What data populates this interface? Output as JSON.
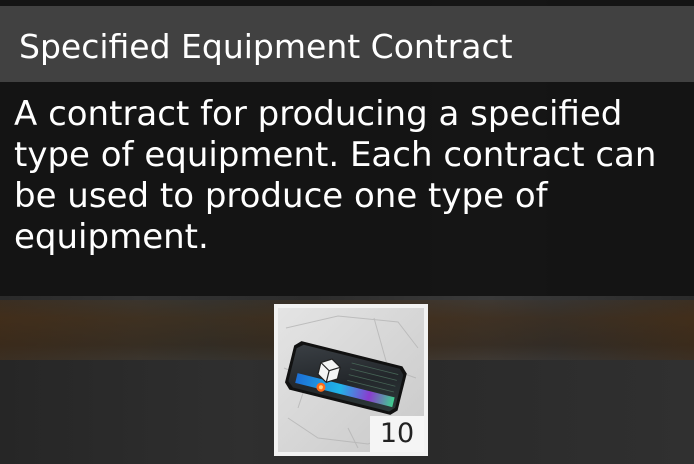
{
  "tooltip": {
    "title": "Specified Equipment Contract",
    "description": "A contract for producing a specified type of equipment. Each contract can be used to produce one type of equipment."
  },
  "item": {
    "icon": "equipment-contract-card-icon",
    "count": "10"
  },
  "colors": {
    "panel_bg": "#121212",
    "title_bar": "#6b6b6b",
    "text": "#ffffff",
    "slot_border": "#f2f2f2",
    "card_accent": "#1e90ff"
  }
}
